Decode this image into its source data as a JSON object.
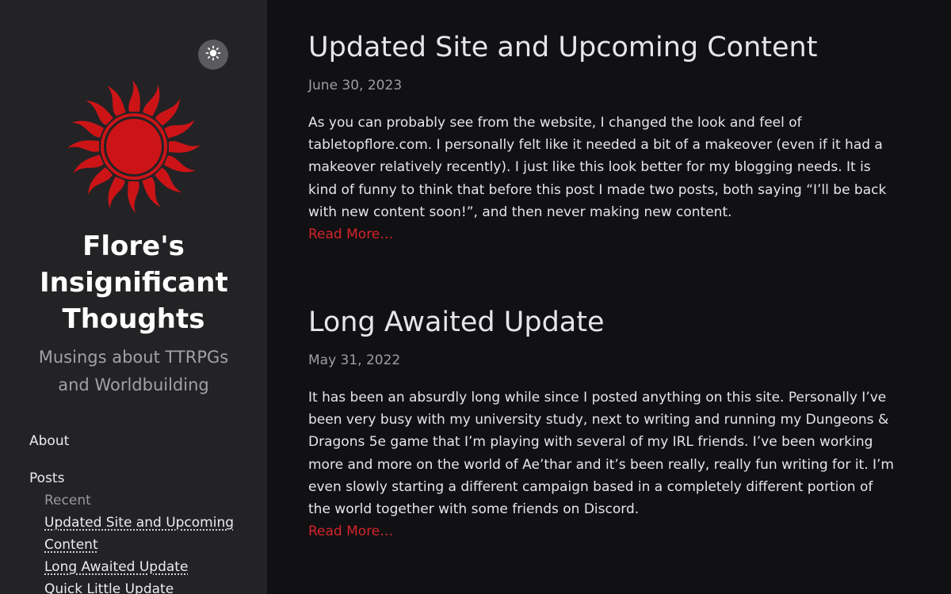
{
  "sidebar": {
    "theme_toggle_icon": "sun-icon",
    "logo_icon": "red-sun-logo-icon",
    "logo_color": "#cc1417",
    "title": "Flore's Insignificant Thoughts",
    "subtitle": "Musings about TTRPGs and Worldbuilding",
    "nav": {
      "about": "About",
      "posts": "Posts",
      "recent_heading": "Recent",
      "recent_posts": [
        "Updated Site and Upcoming Content",
        "Long Awaited Update",
        "Quick Little Update"
      ]
    }
  },
  "posts": [
    {
      "title": "Updated Site and Upcoming Content",
      "date": "June 30, 2023",
      "excerpt": "As you can probably see from the website, I changed the look and feel of tabletopflore.com. I personally felt like it needed a bit of a makeover (even if it had a makeover relatively recently). I just like this look better for my blogging needs. It is kind of funny to think that before this post I made two posts, both saying “I’ll be back with new content soon!”, and then never making new content.",
      "read_more": "Read More…"
    },
    {
      "title": "Long Awaited Update",
      "date": "May 31, 2022",
      "excerpt": "It has been an absurdly long while since I posted anything on this site. Personally I’ve been very busy with my university study, next to writing and running my Dungeons & Dragons 5e game that I’m playing with several of my IRL friends. I’ve been working more and more on the world of Ae’thar and it’s been really, really fun writing for it. I’m even slowly starting a different campaign based in a completely different portion of the world together with some friends on Discord.",
      "read_more": "Read More…"
    }
  ],
  "colors": {
    "background": "#111113",
    "sidebar": "#232325",
    "accent_link": "#d6232a"
  }
}
